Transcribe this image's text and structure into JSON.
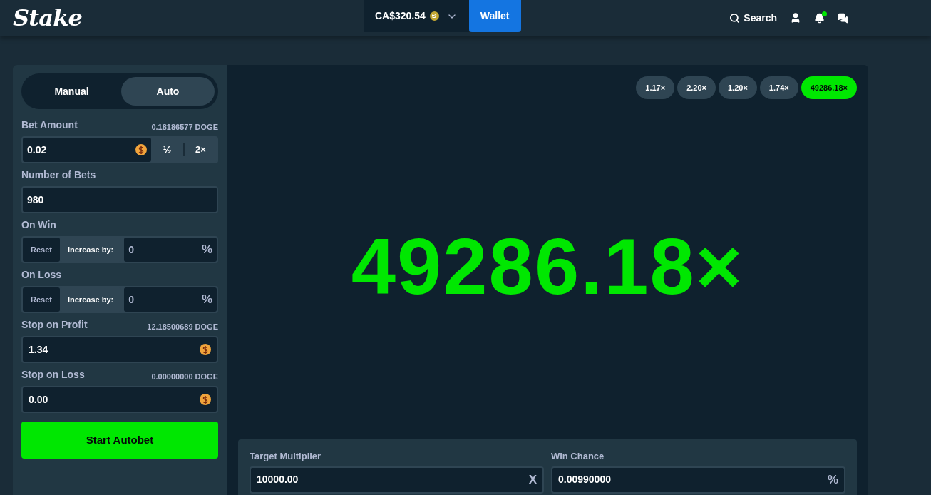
{
  "header": {
    "logo": "Stake",
    "balance": "CA$320.54",
    "currency_symbol": "Đ",
    "wallet": "Wallet",
    "search": "Search",
    "has_notification": true
  },
  "sidebar": {
    "tabs": [
      {
        "label": "Manual",
        "selected": false
      },
      {
        "label": "Auto",
        "selected": true
      }
    ],
    "bet_amount": {
      "label": "Bet Amount",
      "conversion": "0.18186577 DOGE",
      "value": "0.02",
      "half": "½",
      "double": "2×"
    },
    "number_of_bets": {
      "label": "Number of Bets",
      "value": "980"
    },
    "on_win": {
      "label": "On Win",
      "modes": [
        {
          "label": "Reset",
          "selected": true
        },
        {
          "label": "Increase by:",
          "selected": false
        }
      ],
      "value": "0",
      "unit": "%"
    },
    "on_loss": {
      "label": "On Loss",
      "modes": [
        {
          "label": "Reset",
          "selected": true
        },
        {
          "label": "Increase by:",
          "selected": false
        }
      ],
      "value": "0",
      "unit": "%"
    },
    "stop_on_profit": {
      "label": "Stop on Profit",
      "conversion": "12.18500689 DOGE",
      "value": "1.34"
    },
    "stop_on_loss": {
      "label": "Stop on Loss",
      "conversion": "0.00000000 DOGE",
      "value": "0.00"
    },
    "start_button": "Start Autobet"
  },
  "game": {
    "recent_results": [
      {
        "value": "1.17×",
        "won": false
      },
      {
        "value": "2.20×",
        "won": false
      },
      {
        "value": "1.20×",
        "won": false
      },
      {
        "value": "1.74×",
        "won": false
      },
      {
        "value": "49286.18×",
        "won": true
      }
    ],
    "result": "49286.18×",
    "target_multiplier": {
      "label": "Target Multiplier",
      "value": "10000.00",
      "unit": "X"
    },
    "win_chance": {
      "label": "Win Chance",
      "value": "0.00990000",
      "unit": "%"
    }
  }
}
